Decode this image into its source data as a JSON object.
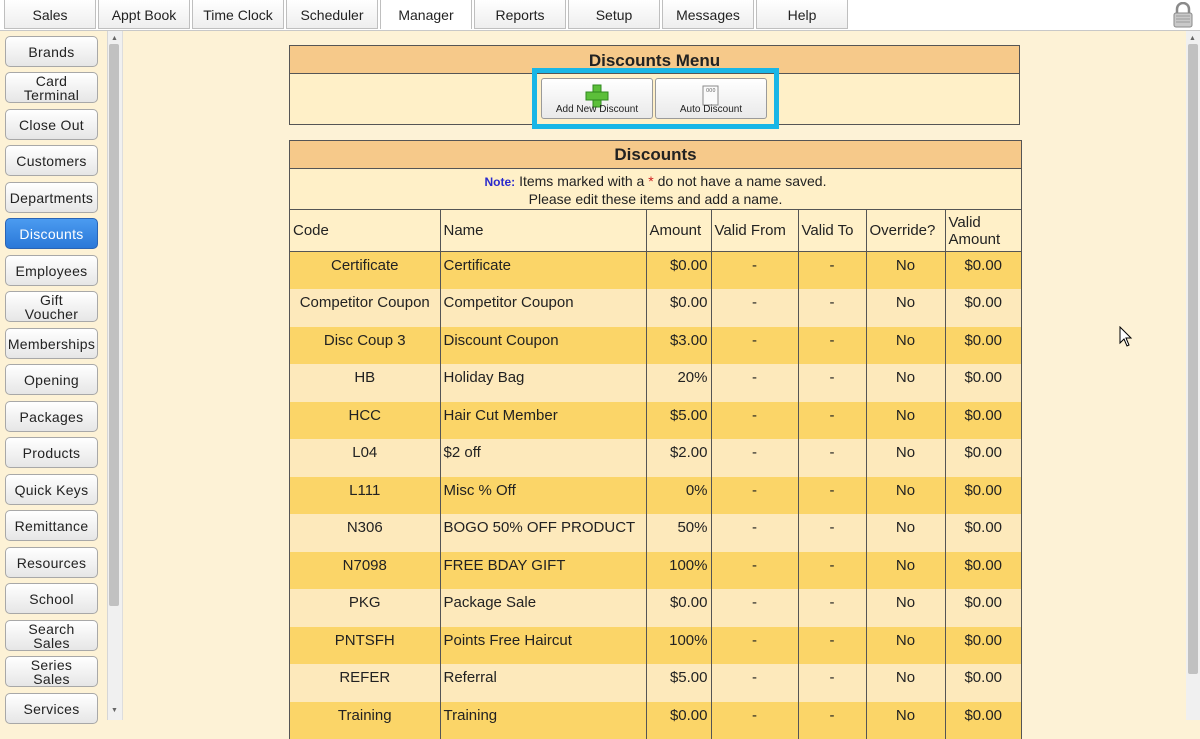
{
  "tabs": [
    "Sales",
    "Appt Book",
    "Time Clock",
    "Scheduler",
    "Manager",
    "Reports",
    "Setup",
    "Messages",
    "Help"
  ],
  "active_tab": "Manager",
  "sidebar": {
    "items": [
      "Brands",
      "Card\nTerminal",
      "Close Out",
      "Customers",
      "Departments",
      "Discounts",
      "Employees",
      "Gift\nVoucher",
      "Memberships",
      "Opening",
      "Packages",
      "Products",
      "Quick Keys",
      "Remittance",
      "Resources",
      "School",
      "Search\nSales",
      "Series\nSales",
      "Services"
    ],
    "active": "Discounts"
  },
  "discounts_menu": {
    "title": "Discounts Menu",
    "add_label": "Add New Discount",
    "auto_label": "Auto Discount"
  },
  "discounts_table": {
    "title": "Discounts",
    "note_label": "Note:",
    "note_text_1": "Items marked with a",
    "note_star": "*",
    "note_text_2": "do not have a name saved.",
    "note_text_3": "Please edit these items and add a name.",
    "headers": [
      "Code",
      "Name",
      "Amount",
      "Valid From",
      "Valid To",
      "Override?",
      "Valid Amount"
    ],
    "rows": [
      [
        "Certificate",
        "Certificate",
        "$0.00",
        "-",
        "-",
        "No",
        "$0.00"
      ],
      [
        "Competitor Coupon",
        "Competitor Coupon",
        "$0.00",
        "-",
        "-",
        "No",
        "$0.00"
      ],
      [
        "Disc Coup 3",
        "Discount Coupon",
        "$3.00",
        "-",
        "-",
        "No",
        "$0.00"
      ],
      [
        "HB",
        "Holiday Bag",
        "20%",
        "-",
        "-",
        "No",
        "$0.00"
      ],
      [
        "HCC",
        "Hair Cut Member",
        "$5.00",
        "-",
        "-",
        "No",
        "$0.00"
      ],
      [
        "L04",
        "$2 off",
        "$2.00",
        "-",
        "-",
        "No",
        "$0.00"
      ],
      [
        "L111",
        "Misc % Off",
        "0%",
        "-",
        "-",
        "No",
        "$0.00"
      ],
      [
        "N306",
        "BOGO 50% OFF PRODUCT",
        "50%",
        "-",
        "-",
        "No",
        "$0.00"
      ],
      [
        "N7098",
        "FREE BDAY GIFT",
        "100%",
        "-",
        "-",
        "No",
        "$0.00"
      ],
      [
        "PKG",
        "Package Sale",
        "$0.00",
        "-",
        "-",
        "No",
        "$0.00"
      ],
      [
        "PNTSFH",
        "Points Free Haircut",
        "100%",
        "-",
        "-",
        "No",
        "$0.00"
      ],
      [
        "REFER",
        "Referral",
        "$5.00",
        "-",
        "-",
        "No",
        "$0.00"
      ],
      [
        "Training",
        "Training",
        "$0.00",
        "-",
        "-",
        "No",
        "$0.00"
      ]
    ]
  },
  "colors": {
    "row_odd": "#fbd568",
    "row_even": "#fde9bb",
    "header_bg": "#f6c98a",
    "highlight": "#19b6e6",
    "active_blue": "#2a78d8"
  }
}
